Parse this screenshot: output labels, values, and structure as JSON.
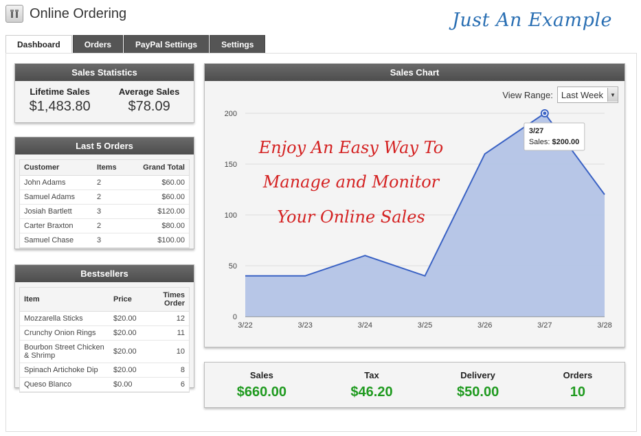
{
  "header": {
    "title": "Online Ordering"
  },
  "tagline": "Just An Example",
  "tabs": [
    {
      "label": "Dashboard",
      "active": true
    },
    {
      "label": "Orders",
      "active": false
    },
    {
      "label": "PayPal Settings",
      "active": false
    },
    {
      "label": "Settings",
      "active": false
    }
  ],
  "sales_statistics": {
    "title": "Sales Statistics",
    "lifetime_label": "Lifetime Sales",
    "lifetime_value": "$1,483.80",
    "average_label": "Average Sales",
    "average_value": "$78.09"
  },
  "last_orders": {
    "title": "Last 5 Orders",
    "columns": [
      "Customer",
      "Items",
      "Grand Total"
    ],
    "rows": [
      [
        "John Adams",
        "2",
        "$60.00"
      ],
      [
        "Samuel Adams",
        "2",
        "$60.00"
      ],
      [
        "Josiah Bartlett",
        "3",
        "$120.00"
      ],
      [
        "Carter Braxton",
        "2",
        "$80.00"
      ],
      [
        "Samuel Chase",
        "3",
        "$100.00"
      ]
    ]
  },
  "bestsellers": {
    "title": "Bestsellers",
    "columns": [
      "Item",
      "Price",
      "Times Order"
    ],
    "rows": [
      [
        "Mozzarella Sticks",
        "$20.00",
        "12"
      ],
      [
        "Crunchy Onion Rings",
        "$20.00",
        "11"
      ],
      [
        "Bourbon Street Chicken & Shrimp",
        "$20.00",
        "10"
      ],
      [
        "Spinach Artichoke Dip",
        "$20.00",
        "8"
      ],
      [
        "Queso Blanco",
        "$0.00",
        "6"
      ]
    ]
  },
  "sales_chart": {
    "title": "Sales Chart",
    "view_range_label": "View Range:",
    "view_range_value": "Last Week",
    "overlay_lines": [
      "Enjoy An Easy Way To",
      "Manage and Monitor",
      "Your Online Sales"
    ],
    "tooltip": {
      "date": "3/27",
      "label": "Sales:",
      "value": "$200.00"
    }
  },
  "chart_data": {
    "type": "area",
    "categories": [
      "3/22",
      "3/23",
      "3/24",
      "3/25",
      "3/26",
      "3/27",
      "3/28"
    ],
    "values": [
      40,
      40,
      60,
      40,
      160,
      200,
      120
    ],
    "yticks": [
      0,
      50,
      100,
      150,
      200
    ],
    "ylim": [
      0,
      200
    ],
    "grid": true,
    "colors": {
      "fill": "#b3c3e6",
      "line": "#3a62c4"
    }
  },
  "totals": [
    {
      "label": "Sales",
      "value": "$660.00"
    },
    {
      "label": "Tax",
      "value": "$46.20"
    },
    {
      "label": "Delivery",
      "value": "$50.00"
    },
    {
      "label": "Orders",
      "value": "10"
    }
  ],
  "colors": {
    "panel_header": "#555555",
    "accent_green": "#1f9a1f",
    "overlay_red": "#d42222",
    "tagline_blue": "#2a6fb3"
  },
  "icons": {
    "app": "tools-icon",
    "dropdown": "chevron-down-icon"
  }
}
